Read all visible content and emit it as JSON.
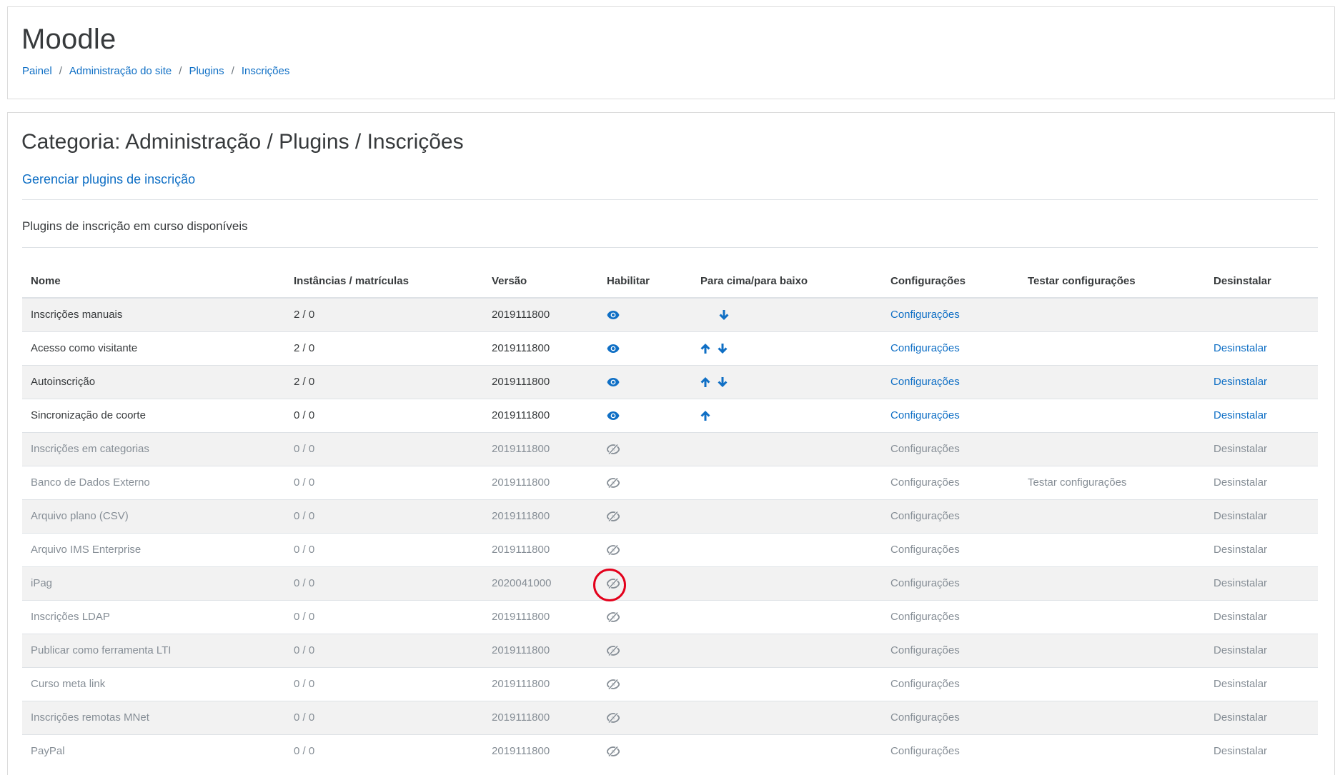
{
  "header": {
    "site_name": "Moodle",
    "breadcrumb": [
      "Painel",
      "Administração do site",
      "Plugins",
      "Inscrições"
    ]
  },
  "page": {
    "heading": "Categoria: Administração / Plugins / Inscrições",
    "manage_link": "Gerenciar plugins de inscrição",
    "subheading": "Plugins de inscrição em curso disponíveis"
  },
  "table": {
    "columns": [
      "Nome",
      "Instâncias / matrículas",
      "Versão",
      "Habilitar",
      "Para cima/para baixo",
      "Configurações",
      "Testar configurações",
      "Desinstalar"
    ],
    "rows": [
      {
        "name": "Inscrições manuais",
        "instances": "2 / 0",
        "version": "2019111800",
        "enabled": true,
        "up": false,
        "down": true,
        "settings": "Configurações",
        "test": "",
        "uninstall": ""
      },
      {
        "name": "Acesso como visitante",
        "instances": "2 / 0",
        "version": "2019111800",
        "enabled": true,
        "up": true,
        "down": true,
        "settings": "Configurações",
        "test": "",
        "uninstall": "Desinstalar"
      },
      {
        "name": "Autoinscrição",
        "instances": "2 / 0",
        "version": "2019111800",
        "enabled": true,
        "up": true,
        "down": true,
        "settings": "Configurações",
        "test": "",
        "uninstall": "Desinstalar"
      },
      {
        "name": "Sincronização de coorte",
        "instances": "0 / 0",
        "version": "2019111800",
        "enabled": true,
        "up": true,
        "down": false,
        "settings": "Configurações",
        "test": "",
        "uninstall": "Desinstalar"
      },
      {
        "name": "Inscrições em categorias",
        "instances": "0 / 0",
        "version": "2019111800",
        "enabled": false,
        "up": false,
        "down": false,
        "settings": "Configurações",
        "test": "",
        "uninstall": "Desinstalar"
      },
      {
        "name": "Banco de Dados Externo",
        "instances": "0 / 0",
        "version": "2019111800",
        "enabled": false,
        "up": false,
        "down": false,
        "settings": "Configurações",
        "test": "Testar configurações",
        "uninstall": "Desinstalar"
      },
      {
        "name": "Arquivo plano (CSV)",
        "instances": "0 / 0",
        "version": "2019111800",
        "enabled": false,
        "up": false,
        "down": false,
        "settings": "Configurações",
        "test": "",
        "uninstall": "Desinstalar"
      },
      {
        "name": "Arquivo IMS Enterprise",
        "instances": "0 / 0",
        "version": "2019111800",
        "enabled": false,
        "up": false,
        "down": false,
        "settings": "Configurações",
        "test": "",
        "uninstall": "Desinstalar"
      },
      {
        "name": "iPag",
        "instances": "0 / 0",
        "version": "2020041000",
        "enabled": false,
        "up": false,
        "down": false,
        "settings": "Configurações",
        "test": "",
        "uninstall": "Desinstalar"
      },
      {
        "name": "Inscrições LDAP",
        "instances": "0 / 0",
        "version": "2019111800",
        "enabled": false,
        "up": false,
        "down": false,
        "settings": "Configurações",
        "test": "",
        "uninstall": "Desinstalar"
      },
      {
        "name": "Publicar como ferramenta LTI",
        "instances": "0 / 0",
        "version": "2019111800",
        "enabled": false,
        "up": false,
        "down": false,
        "settings": "Configurações",
        "test": "",
        "uninstall": "Desinstalar"
      },
      {
        "name": "Curso meta link",
        "instances": "0 / 0",
        "version": "2019111800",
        "enabled": false,
        "up": false,
        "down": false,
        "settings": "Configurações",
        "test": "",
        "uninstall": "Desinstalar"
      },
      {
        "name": "Inscrições remotas MNet",
        "instances": "0 / 0",
        "version": "2019111800",
        "enabled": false,
        "up": false,
        "down": false,
        "settings": "Configurações",
        "test": "",
        "uninstall": "Desinstalar"
      },
      {
        "name": "PayPal",
        "instances": "0 / 0",
        "version": "2019111800",
        "enabled": false,
        "up": false,
        "down": false,
        "settings": "Configurações",
        "test": "",
        "uninstall": "Desinstalar"
      }
    ]
  },
  "colors": {
    "link": "#0f6fc5",
    "muted": "#868e96",
    "stripe": "#f2f2f2",
    "annotation": "#e3001b"
  },
  "icons": {
    "enabled": "eye-icon",
    "disabled": "eye-slash-icon",
    "up": "arrow-up-icon",
    "down": "arrow-down-icon"
  }
}
